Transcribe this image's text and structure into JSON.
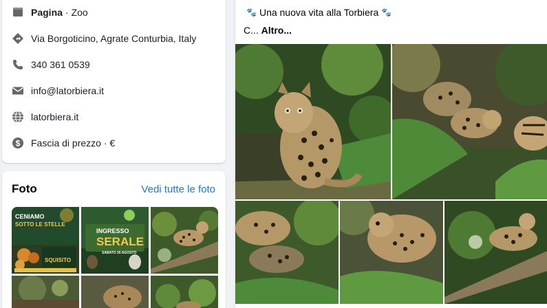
{
  "intro": {
    "category_type": "Pagina",
    "category_sep": "·",
    "category_value": "Zoo",
    "address": "Via Borgoticino, Agrate Conturbia, Italy",
    "phone": "340 361 0539",
    "email": "info@latorbiera.it",
    "website": "latorbiera.it",
    "price": "Fascia di prezzo · €"
  },
  "photos": {
    "title": "Foto",
    "see_all": "Vedi tutte le foto",
    "poster1": {
      "line1": "CENIAMO",
      "line2": "SOTTO LE STELLE",
      "line3": "SQUISITO"
    },
    "poster2": {
      "line1": "INGRESSO",
      "line2": "SERALE",
      "line3": "SABATO 26 AGOSTO"
    }
  },
  "post": {
    "text": "Una nuova vita alla Torbiera",
    "paw": "🐾",
    "truncated": "C...",
    "more": "Altro..."
  },
  "icons": {
    "category": "flag-icon",
    "address": "location-diamond-icon",
    "phone": "phone-icon",
    "email": "envelope-icon",
    "website": "globe-icon",
    "price": "dollar-icon"
  }
}
